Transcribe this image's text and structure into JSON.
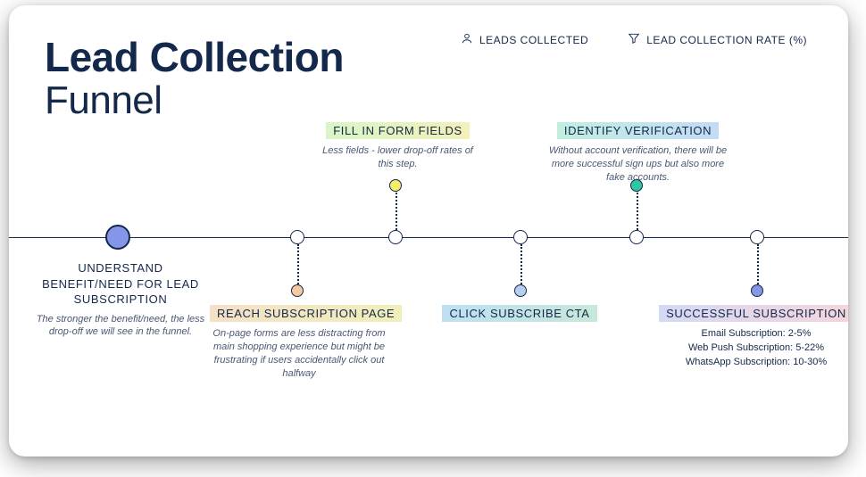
{
  "title_line1": "Lead Collection",
  "title_line2": "Funnel",
  "legend": {
    "item1": "LEADS COLLECTED",
    "item2": "LEAD COLLECTION RATE (%)"
  },
  "steps": {
    "s1": {
      "title": "UNDERSTAND BENEFIT/NEED FOR LEAD SUBSCRIPTION",
      "desc": "The stronger the benefit/need, the less drop-off we will see in the funnel."
    },
    "s2": {
      "title": "REACH SUBSCRIPTION PAGE",
      "desc": "On-page forms are less distracting from main shopping experience but might be frustrating if users accidentally click out halfway"
    },
    "s3": {
      "title": "FILL IN FORM FIELDS",
      "desc": "Less fields - lower drop-off rates of this step."
    },
    "s4": {
      "title": "CLICK SUBSCRIBE CTA"
    },
    "s5": {
      "title": "IDENTIFY VERIFICATION",
      "desc": "Without account verification, there will be more successful sign ups but also more fake accounts."
    },
    "s6": {
      "title": "SUCCESSFUL SUBSCRIPTION",
      "stat1_k": "Email Subscription:",
      "stat1_v": " 2-5%",
      "stat2_k": "Web Push Subscription:",
      "stat2_v": " 5-22%",
      "stat3_k": "WhatsApp Subscription:",
      "stat3_v": " 10-30%"
    }
  }
}
